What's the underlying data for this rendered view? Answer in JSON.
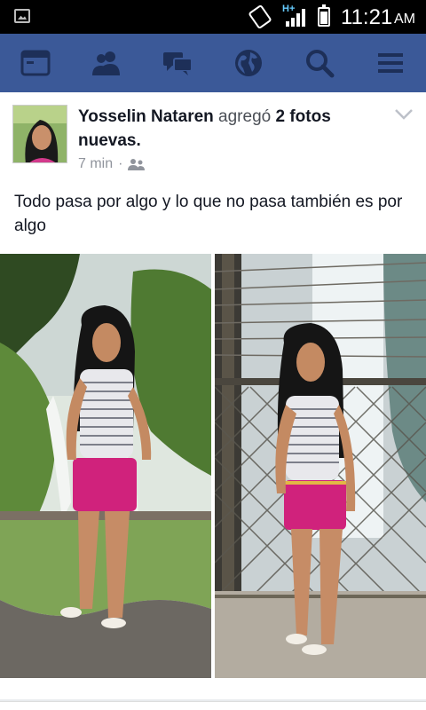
{
  "status_bar": {
    "network": "H+",
    "time": "11:21",
    "ampm": "AM",
    "icons": [
      "image-notification-icon",
      "screen-rotation-icon",
      "signal-icon",
      "battery-icon"
    ]
  },
  "nav": {
    "color": "#3b5998",
    "items": [
      {
        "icon": "news-feed-icon"
      },
      {
        "icon": "friend-requests-icon"
      },
      {
        "icon": "messages-icon"
      },
      {
        "icon": "notifications-globe-icon"
      },
      {
        "icon": "search-icon"
      },
      {
        "icon": "menu-icon"
      }
    ]
  },
  "post": {
    "author": "Yosselin Nataren",
    "verb": "agregó",
    "photo_count": "2 fotos",
    "photo_suffix": "nuevas.",
    "time": "7 min",
    "separator": "·",
    "privacy_icon": "friends-icon",
    "text": "Todo pasa por algo y lo que no pasa también es por algo",
    "photos": [
      {
        "icon": "photo-girl-waterfall"
      },
      {
        "icon": "photo-girl-fence"
      }
    ]
  }
}
